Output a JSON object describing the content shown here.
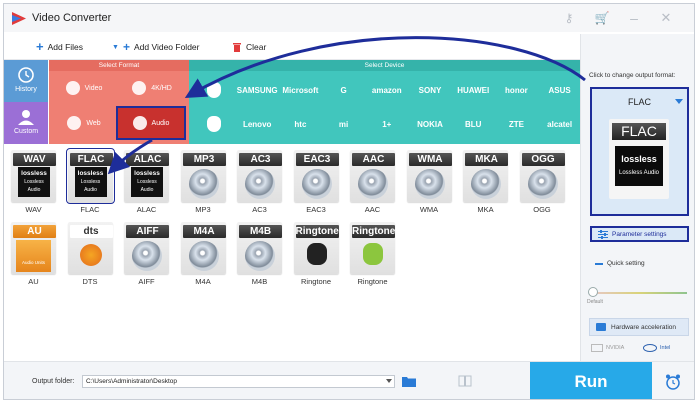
{
  "window": {
    "title": "Video Converter"
  },
  "toolbar": {
    "add_files": "Add Files",
    "add_video_folder": "Add Video Folder",
    "clear": "Clear"
  },
  "format_bar": {
    "tabs": [
      {
        "label": "History",
        "color": "#5b9bd5"
      },
      {
        "label": "Custom",
        "color": "#9b6fd6"
      }
    ],
    "select_format_header": "Select Format",
    "select_device_header": "Select Device",
    "format_cells": [
      {
        "label": "Video",
        "icon": "video-icon"
      },
      {
        "label": "4K/HD",
        "icon": "4k-icon"
      },
      {
        "label": "Web",
        "icon": "web-icon"
      },
      {
        "label": "Audio",
        "icon": "audio-icon"
      }
    ],
    "device_row1": [
      "",
      "SAMSUNG",
      "Microsoft",
      "G",
      "amazon",
      "SONY",
      "HUAWEI",
      "honor",
      "ASUS"
    ],
    "device_row2": [
      "",
      "Lenovo",
      "htc",
      "mi",
      "1+",
      "NOKIA",
      "BLU",
      "ZTE",
      "alcatel",
      "TV"
    ],
    "colors": {
      "format": "#ef7f73",
      "device": "#41c6bd",
      "selected": "#c8312e"
    }
  },
  "grid": {
    "tiles": [
      {
        "name": "WAV",
        "label": "WAV",
        "kind": "lossless",
        "sub": "Lossless Audio"
      },
      {
        "name": "FLAC",
        "label": "FLAC",
        "kind": "lossless",
        "sub": "Lossless Audio",
        "selected": true
      },
      {
        "name": "ALAC",
        "label": "ALAC",
        "kind": "lossless",
        "sub": "Lossless Audio"
      },
      {
        "name": "MP3",
        "label": "MP3",
        "kind": "disc"
      },
      {
        "name": "AC3",
        "label": "AC3",
        "kind": "disc"
      },
      {
        "name": "EAC3",
        "label": "EAC3",
        "kind": "disc"
      },
      {
        "name": "AAC",
        "label": "AAC",
        "kind": "disc"
      },
      {
        "name": "WMA",
        "label": "WMA",
        "kind": "disc"
      },
      {
        "name": "MKA",
        "label": "MKA",
        "kind": "disc"
      },
      {
        "name": "OGG",
        "label": "OGG",
        "kind": "disc"
      },
      {
        "name": "AU",
        "label": "AU",
        "kind": "au",
        "sub": "Audio Units"
      },
      {
        "name": "dts",
        "label": "DTS",
        "kind": "dts"
      },
      {
        "name": "AIFF",
        "label": "AIFF",
        "kind": "disc"
      },
      {
        "name": "M4A",
        "label": "M4A",
        "kind": "disc"
      },
      {
        "name": "M4B",
        "label": "M4B",
        "kind": "disc"
      },
      {
        "name": "Ringtone",
        "label": "Ringtone",
        "kind": "ring-apple"
      },
      {
        "name": "Ringtone",
        "label": "Ringtone",
        "kind": "ring-android"
      }
    ]
  },
  "right_panel": {
    "hint": "Click to change output format:",
    "output_format": "FLAC",
    "card_header": "FLAC",
    "card_badge": "lossless",
    "card_sub": "Lossless Audio",
    "parameter_settings": "Parameter settings",
    "quick_setting": "Quick setting",
    "default_label": "Default",
    "hardware_acceleration": "Hardware acceleration",
    "vendor_nvidia": "NVIDIA",
    "vendor_intel": "Intel"
  },
  "bottom": {
    "output_folder_label": "Output folder:",
    "output_folder_value": "C:\\Users\\Administrator\\Desktop",
    "run": "Run"
  }
}
